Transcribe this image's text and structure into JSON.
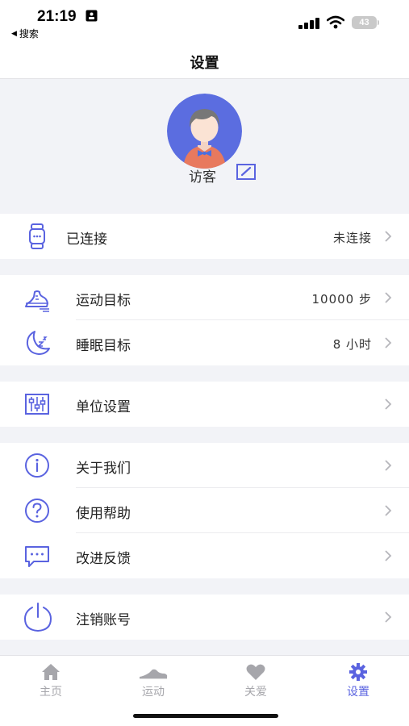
{
  "status": {
    "time": "21:19",
    "back_label": "搜索",
    "battery": "43"
  },
  "header": {
    "title": "设置"
  },
  "profile": {
    "name": "访客"
  },
  "rows": {
    "connection": {
      "label": "已连接",
      "value": "未连接"
    },
    "steps_goal": {
      "label": "运动目标",
      "value": "10000 步"
    },
    "sleep_goal": {
      "label": "睡眠目标",
      "value": "8 小时"
    },
    "units": {
      "label": "单位设置"
    },
    "about": {
      "label": "关于我们"
    },
    "help": {
      "label": "使用帮助"
    },
    "feedback": {
      "label": "改进反馈"
    },
    "delete_account": {
      "label": "注销账号"
    }
  },
  "tabs": [
    {
      "label": "主页",
      "icon": "home-icon",
      "active": false
    },
    {
      "label": "运动",
      "icon": "sneaker-icon",
      "active": false
    },
    {
      "label": "关爱",
      "icon": "heart-icon",
      "active": false
    },
    {
      "label": "设置",
      "icon": "gear-icon",
      "active": true
    }
  ],
  "colors": {
    "accent": "#5a63e0",
    "background": "#f2f3f7",
    "inactive": "#a6a6ab"
  }
}
